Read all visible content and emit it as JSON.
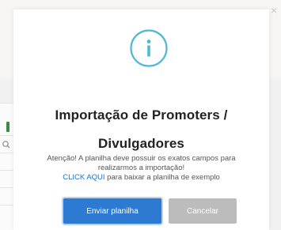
{
  "dialog": {
    "title_line1": "Importação de Promoters /",
    "title_line2": "Divulgadores",
    "message_line1": "Atenção! A planilha deve possuir os exatos campos para",
    "message_line2": "realizarmos a importação!",
    "link_text": "CLICK AQUI",
    "message_line3_rest": " para baixar a planilha de exemplo",
    "primary_button": "Enviar planilha",
    "cancel_button": "Cancelar",
    "close_glyph": "×",
    "icon": "info-icon"
  },
  "colors": {
    "accent": "#2c7ad1",
    "icon_teal": "#4fb7d8",
    "link": "#1a73c5",
    "cancel": "#bcbcbc",
    "title": "#222222"
  }
}
